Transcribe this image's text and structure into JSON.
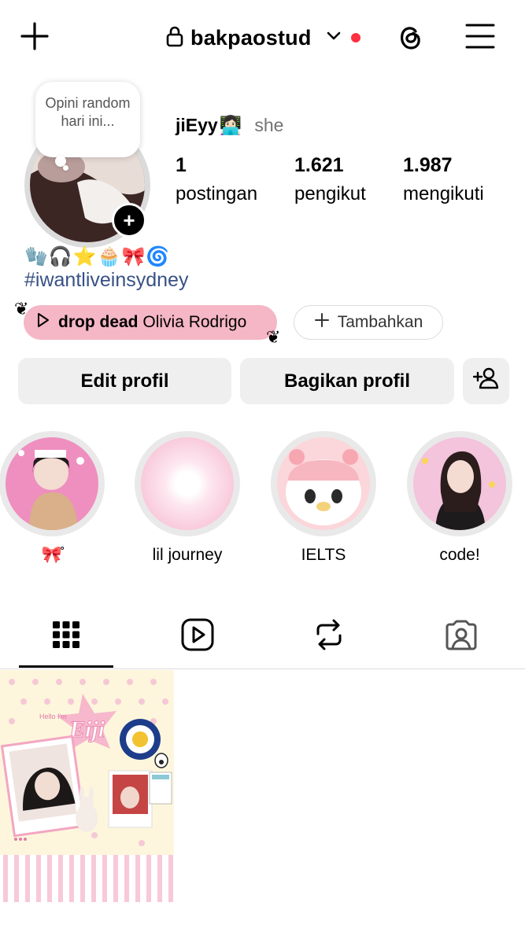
{
  "header": {
    "username": "bakpaostud",
    "has_notification_dot": true,
    "accent_red": "#ff3040"
  },
  "note": {
    "text": "Opini random hari ini..."
  },
  "profile": {
    "display_name": "jiEyy",
    "display_name_emoji": "👩🏻‍💻",
    "pronoun": "she",
    "stats": [
      {
        "value": "1",
        "label": "postingan"
      },
      {
        "value": "1.621",
        "label": "pengikut"
      },
      {
        "value": "1.987",
        "label": "mengikuti"
      }
    ],
    "bio_emojis": "🧤🎧⭐🧁🎀🌀",
    "hashtag": "#iwantliveinsydney",
    "hashtag_color": "#385185"
  },
  "music": {
    "song": "drop dead",
    "artist": "Olivia Rodrigo",
    "pill_color": "#f5b6c5"
  },
  "add_button": {
    "label": "Tambahkan"
  },
  "actions": {
    "edit": "Edit profil",
    "share": "Bagikan profil"
  },
  "highlights": [
    {
      "label": "🎀̊"
    },
    {
      "label": "lil journey"
    },
    {
      "label": "IELTS"
    },
    {
      "label": "code!"
    }
  ],
  "tabs": [
    "grid",
    "reels",
    "reposts",
    "tagged"
  ],
  "post": {
    "texts": [
      "Eiji",
      "Hello I'm",
      "UNIVERSITAS AIRLANGGA",
      "UNAIR"
    ]
  }
}
